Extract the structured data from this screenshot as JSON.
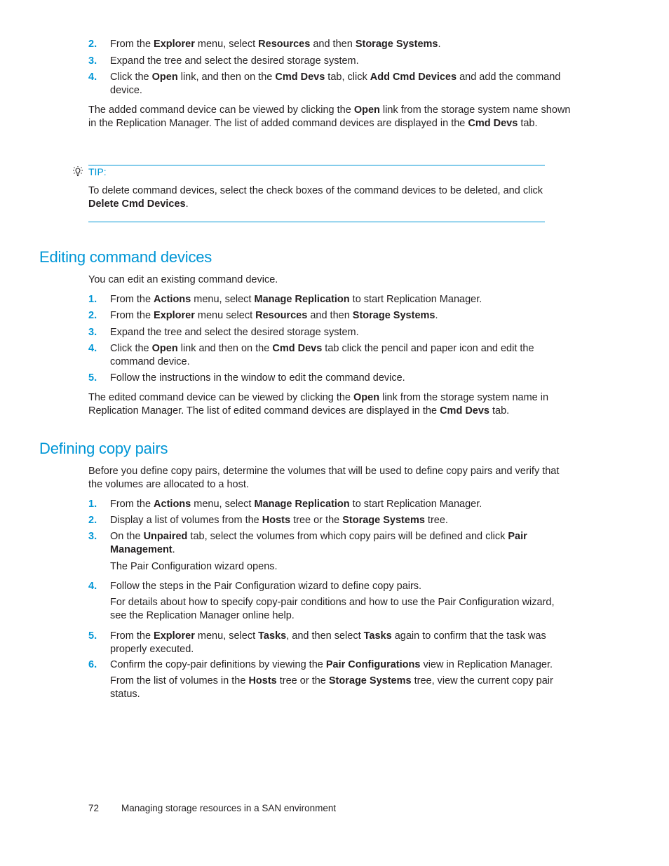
{
  "intro_steps": [
    {
      "num": "2.",
      "parts": [
        [
          "From the ",
          ""
        ],
        [
          "Explorer",
          "b"
        ],
        [
          " menu, select ",
          ""
        ],
        [
          "Resources",
          "b"
        ],
        [
          " and then ",
          ""
        ],
        [
          "Storage Systems",
          "b"
        ],
        [
          ".",
          ""
        ]
      ]
    },
    {
      "num": "3.",
      "parts": [
        [
          "Expand the tree and select the desired storage system.",
          ""
        ]
      ]
    },
    {
      "num": "4.",
      "parts": [
        [
          "Click the ",
          ""
        ],
        [
          "Open",
          "b"
        ],
        [
          " link, and then on the ",
          ""
        ],
        [
          "Cmd Devs",
          "b"
        ],
        [
          " tab, click ",
          ""
        ],
        [
          "Add Cmd Devices",
          "b"
        ],
        [
          " and add the command device.",
          ""
        ]
      ]
    }
  ],
  "intro_para": [
    [
      "The added command device can be viewed by clicking the ",
      ""
    ],
    [
      "Open",
      "b"
    ],
    [
      " link from the storage system name shown in the Replication Manager. The list of added command devices are displayed in the ",
      ""
    ],
    [
      "Cmd Devs",
      "b"
    ],
    [
      " tab.",
      ""
    ]
  ],
  "tip": {
    "icon": "lightbulb-icon",
    "label": "TIP:",
    "parts": [
      [
        "To delete command devices, select the check boxes of the command devices to be deleted, and click ",
        ""
      ],
      [
        "Delete Cmd Devices",
        "b"
      ],
      [
        ".",
        ""
      ]
    ]
  },
  "section1": {
    "title": "Editing command devices",
    "intro": "You can edit an existing command device.",
    "steps": [
      {
        "num": "1.",
        "parts": [
          [
            "From the ",
            ""
          ],
          [
            "Actions",
            "b"
          ],
          [
            " menu, select ",
            ""
          ],
          [
            "Manage Replication",
            "b"
          ],
          [
            " to start Replication Manager.",
            ""
          ]
        ]
      },
      {
        "num": "2.",
        "parts": [
          [
            "From the ",
            ""
          ],
          [
            "Explorer",
            "b"
          ],
          [
            " menu select ",
            ""
          ],
          [
            "Resources",
            "b"
          ],
          [
            " and then ",
            ""
          ],
          [
            "Storage Systems",
            "b"
          ],
          [
            ".",
            ""
          ]
        ]
      },
      {
        "num": "3.",
        "parts": [
          [
            "Expand the tree and select the desired storage system.",
            ""
          ]
        ]
      },
      {
        "num": "4.",
        "parts": [
          [
            "Click the ",
            ""
          ],
          [
            "Open",
            "b"
          ],
          [
            " link and then on the ",
            ""
          ],
          [
            "Cmd Devs",
            "b"
          ],
          [
            " tab click the pencil and paper icon and edit the command device.",
            ""
          ]
        ]
      },
      {
        "num": "5.",
        "parts": [
          [
            "Follow the instructions in the window to edit the command device.",
            ""
          ]
        ]
      }
    ],
    "outro": [
      [
        "The edited command device can be viewed by clicking the ",
        ""
      ],
      [
        "Open",
        "b"
      ],
      [
        " link from the storage system name in Replication Manager. The list of edited command devices are displayed in the ",
        ""
      ],
      [
        "Cmd Devs",
        "b"
      ],
      [
        " tab.",
        ""
      ]
    ]
  },
  "section2": {
    "title": "Defining copy pairs",
    "intro": "Before you define copy pairs, determine the volumes that will be used to define copy pairs and verify that the volumes are allocated to a host.",
    "steps": [
      {
        "num": "1.",
        "parts": [
          [
            "From the ",
            ""
          ],
          [
            "Actions",
            "b"
          ],
          [
            " menu, select ",
            ""
          ],
          [
            "Manage Replication",
            "b"
          ],
          [
            " to start Replication Manager.",
            ""
          ]
        ]
      },
      {
        "num": "2.",
        "parts": [
          [
            "Display a list of volumes from the ",
            ""
          ],
          [
            "Hosts",
            "b"
          ],
          [
            " tree or the ",
            ""
          ],
          [
            "Storage Systems",
            "b"
          ],
          [
            " tree.",
            ""
          ]
        ]
      },
      {
        "num": "3.",
        "parts": [
          [
            "On the ",
            ""
          ],
          [
            "Unpaired",
            "b"
          ],
          [
            " tab, select the volumes from which copy pairs will be defined and click ",
            ""
          ],
          [
            "Pair Management",
            "b"
          ],
          [
            ".",
            ""
          ]
        ]
      },
      {
        "num": "4.",
        "parts": [
          [
            "Follow the steps in the Pair Configuration wizard to define copy pairs.",
            ""
          ]
        ]
      },
      {
        "num": "5.",
        "parts": [
          [
            "From the ",
            ""
          ],
          [
            "Explorer",
            "b"
          ],
          [
            " menu, select ",
            ""
          ],
          [
            "Tasks",
            "b"
          ],
          [
            ", and then select ",
            ""
          ],
          [
            "Tasks",
            "b"
          ],
          [
            " again to confirm that the task was properly executed.",
            ""
          ]
        ]
      },
      {
        "num": "6.",
        "parts": [
          [
            "Confirm the copy-pair definitions by viewing the ",
            ""
          ],
          [
            "Pair Configurations",
            "b"
          ],
          [
            " view in Replication Manager.",
            ""
          ]
        ]
      }
    ],
    "step3_note": "The Pair Configuration wizard opens.",
    "step4_note": "For details about how to specify copy-pair conditions and how to use the Pair Configuration wizard, see the Replication Manager online help.",
    "step6_note": [
      [
        "From the list of volumes in the ",
        ""
      ],
      [
        "Hosts",
        "b"
      ],
      [
        " tree or the ",
        ""
      ],
      [
        "Storage Systems",
        "b"
      ],
      [
        " tree, view the current copy pair status.",
        ""
      ]
    ]
  },
  "footer": {
    "page_number": "72",
    "chapter": "Managing storage resources in a SAN environment"
  }
}
